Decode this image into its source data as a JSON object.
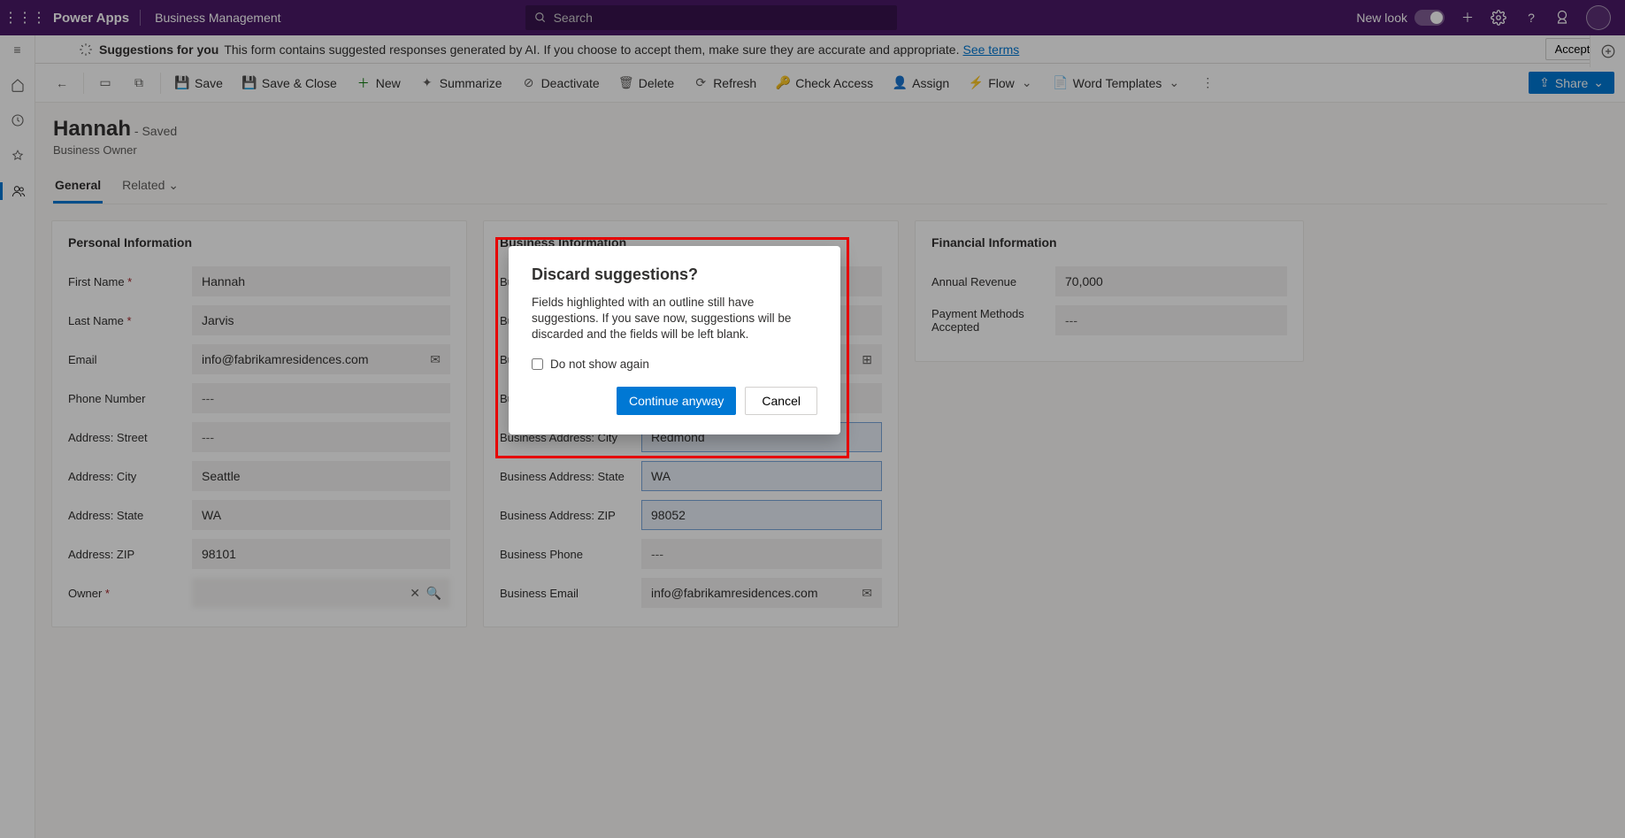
{
  "topbar": {
    "product": "Power Apps",
    "appName": "Business Management",
    "searchPlaceholder": "Search",
    "newLook": "New look"
  },
  "suggestBar": {
    "title": "Suggestions for you",
    "text": "This form contains suggested responses generated by AI. If you choose to accept them, make sure they are accurate and appropriate.",
    "link": "See terms",
    "accept": "Accept all"
  },
  "commands": {
    "save": "Save",
    "saveClose": "Save & Close",
    "new": "New",
    "summarize": "Summarize",
    "deactivate": "Deactivate",
    "delete": "Delete",
    "refresh": "Refresh",
    "checkAccess": "Check Access",
    "assign": "Assign",
    "flow": "Flow",
    "wordTemplates": "Word Templates",
    "share": "Share"
  },
  "record": {
    "name": "Hannah",
    "state": "- Saved",
    "type": "Business Owner",
    "tabs": {
      "general": "General",
      "related": "Related"
    }
  },
  "sections": {
    "personal": {
      "title": "Personal Information",
      "firstName": {
        "label": "First Name",
        "value": "Hannah"
      },
      "lastName": {
        "label": "Last Name",
        "value": "Jarvis"
      },
      "email": {
        "label": "Email",
        "value": "info@fabrikamresidences.com"
      },
      "phone": {
        "label": "Phone Number",
        "value": "---"
      },
      "street": {
        "label": "Address: Street",
        "value": "---"
      },
      "city": {
        "label": "Address: City",
        "value": "Seattle"
      },
      "state": {
        "label": "Address: State",
        "value": "WA"
      },
      "zip": {
        "label": "Address: ZIP",
        "value": "98101"
      },
      "owner": {
        "label": "Owner",
        "value": ""
      }
    },
    "business": {
      "title": "Business Information",
      "bname": {
        "label": "Business Name",
        "value": ""
      },
      "btype": {
        "label": "Business Type",
        "value": ""
      },
      "bdesc": {
        "label": "Business Description",
        "value": ""
      },
      "bstreet": {
        "label": "Business Address: Street",
        "value": ""
      },
      "bcity": {
        "label": "Business Address: City",
        "value": "Redmond"
      },
      "bstate": {
        "label": "Business Address: State",
        "value": "WA"
      },
      "bzip": {
        "label": "Business Address: ZIP",
        "value": "98052"
      },
      "bphone": {
        "label": "Business Phone",
        "value": "---"
      },
      "bemail": {
        "label": "Business Email",
        "value": "info@fabrikamresidences.com"
      }
    },
    "financial": {
      "title": "Financial Information",
      "revenue": {
        "label": "Annual Revenue",
        "value": "70,000"
      },
      "payment": {
        "label": "Payment Methods Accepted",
        "value": "---"
      }
    }
  },
  "modal": {
    "title": "Discard suggestions?",
    "body": "Fields highlighted with an outline still have suggestions. If you save now, suggestions will be discarded and the fields will be left blank.",
    "checkbox": "Do not show again",
    "continue": "Continue anyway",
    "cancel": "Cancel"
  }
}
